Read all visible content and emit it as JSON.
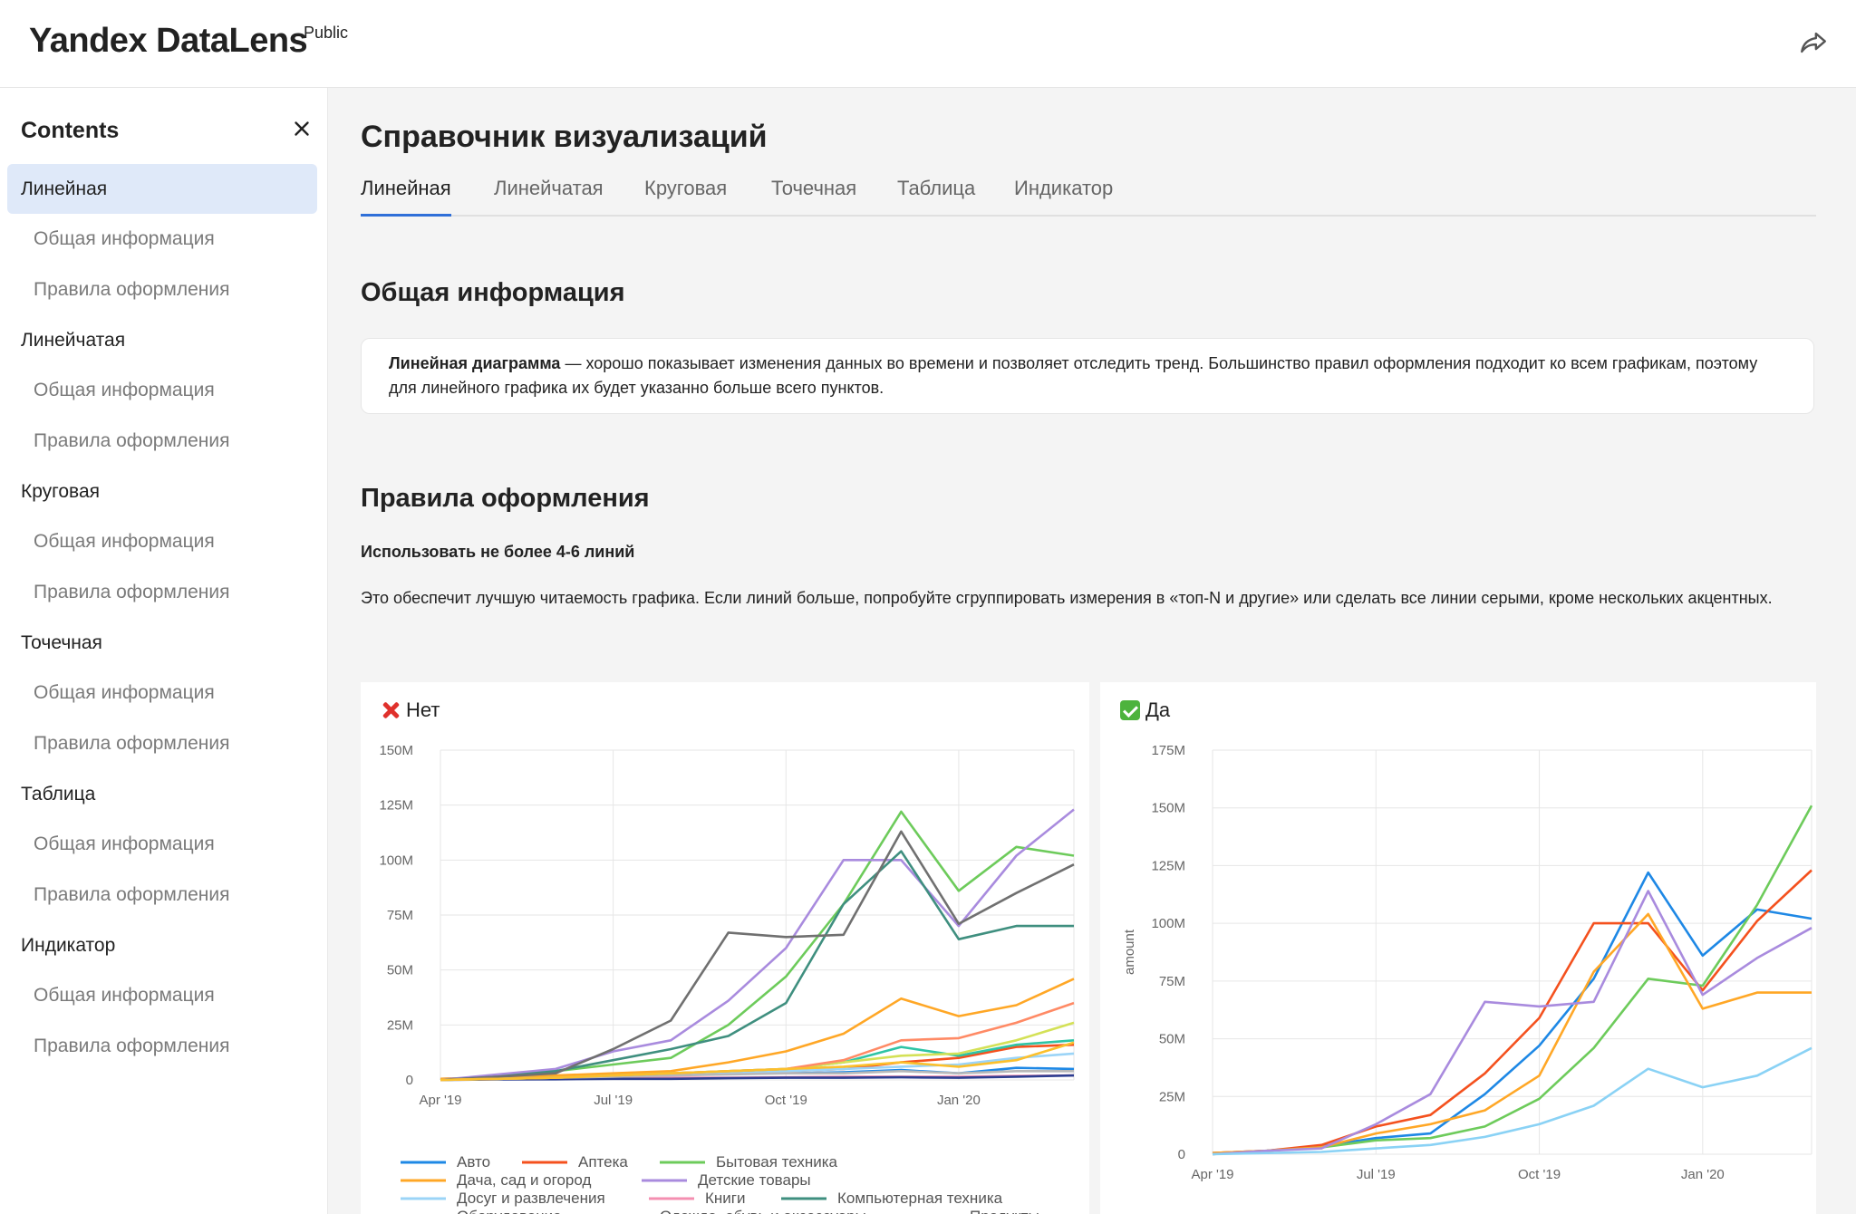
{
  "header": {
    "logo": "Yandex DataLens",
    "logo_badge": "Public",
    "share_icon": "share-icon"
  },
  "sidebar": {
    "title": "Contents",
    "close_icon": "close-icon",
    "items": [
      {
        "label": "Линейная",
        "level": 1,
        "active": true
      },
      {
        "label": "Общая информация",
        "level": 2
      },
      {
        "label": "Правила оформления",
        "level": 2
      },
      {
        "label": "Линейчатая",
        "level": 1
      },
      {
        "label": "Общая информация",
        "level": 2
      },
      {
        "label": "Правила оформления",
        "level": 2
      },
      {
        "label": "Круговая",
        "level": 1
      },
      {
        "label": "Общая информация",
        "level": 2
      },
      {
        "label": "Правила оформления",
        "level": 2
      },
      {
        "label": "Точечная",
        "level": 1
      },
      {
        "label": "Общая информация",
        "level": 2
      },
      {
        "label": "Правила оформления",
        "level": 2
      },
      {
        "label": "Таблица",
        "level": 1
      },
      {
        "label": "Общая информация",
        "level": 2
      },
      {
        "label": "Правила оформления",
        "level": 2
      },
      {
        "label": "Индикатор",
        "level": 1
      },
      {
        "label": "Общая информация",
        "level": 2
      },
      {
        "label": "Правила оформления",
        "level": 2
      }
    ]
  },
  "main": {
    "title": "Справочник визуализаций",
    "tabs": [
      {
        "label": "Линейная",
        "active": true
      },
      {
        "label": "Линейчатая"
      },
      {
        "label": "Круговая"
      },
      {
        "label": "Точечная"
      },
      {
        "label": "Таблица"
      },
      {
        "label": "Индикатор"
      }
    ],
    "section1_title": "Общая информация",
    "info_bold": "Линейная диаграмма",
    "info_text": " — хорошо показывает изменения данных во времени и позволяет отследить тренд. Большинство правил оформления подходит ко всем графикам, поэтому для линейного графика их будет указанно больше всего пунктов.",
    "section2_title": "Правила оформления",
    "rule_title": "Использовать не более 4-6 линий",
    "rule_text": "Это обеспечит лучшую читаемость графика. Если линий больше, попробуйте сгруппировать измерения в «топ-N и другие» или сделать все линии серыми, кроме нескольких акцентных.",
    "bad_label": "Нет",
    "good_label": "Да"
  },
  "chart_data": [
    {
      "type": "line",
      "title": "Нет",
      "x": [
        "Apr '19",
        "May '19",
        "Jun '19",
        "Jul '19",
        "Aug '19",
        "Sep '19",
        "Oct '19",
        "Nov '19",
        "Dec '19",
        "Jan '20",
        "Feb '20",
        "Mar '20"
      ],
      "x_ticks": [
        "Apr '19",
        "Jul '19",
        "Oct '19",
        "Jan '20"
      ],
      "y_ticks": [
        "0",
        "25M",
        "50M",
        "75M",
        "100M",
        "125M",
        "150M"
      ],
      "ylim": [
        0,
        150
      ],
      "ylabel": "",
      "legend": "bottom",
      "series": [
        {
          "name": "Авто",
          "color": "#1e88e5",
          "values": [
            0.5,
            1,
            2,
            2.5,
            2.5,
            3,
            3,
            3.5,
            4.5,
            3,
            5.5,
            5
          ]
        },
        {
          "name": "Аптека",
          "color": "#f4511e",
          "values": [
            0.5,
            1,
            1.5,
            2,
            2.5,
            3,
            4,
            5,
            8,
            10,
            15,
            16
          ]
        },
        {
          "name": "Бытовая техника",
          "color": "#6dcb5b",
          "values": [
            0,
            1.5,
            4,
            7,
            10,
            25,
            47,
            80,
            122,
            86,
            106,
            102
          ]
        },
        {
          "name": "Дача, сад и огород",
          "color": "#ffa726",
          "values": [
            0.5,
            1,
            2,
            3,
            4,
            8,
            13,
            21,
            37,
            29,
            34,
            46
          ]
        },
        {
          "name": "Детские товары",
          "color": "#a98bde",
          "values": [
            0,
            2.5,
            5,
            13,
            18,
            36,
            60,
            100,
            100,
            70,
            102,
            123
          ]
        },
        {
          "name": "Досуг и развлечения",
          "color": "#9bd4f7",
          "values": [
            0,
            0.5,
            1,
            1.5,
            2,
            3,
            4,
            5,
            6,
            7,
            10,
            12
          ]
        },
        {
          "name": "Книги",
          "color": "#f48fb1",
          "values": [
            0,
            0.5,
            0.5,
            0.8,
            1,
            1,
            1.2,
            1.5,
            1.5,
            1.5,
            1.8,
            2
          ]
        },
        {
          "name": "Компьютерная техника",
          "color": "#3f8f7f",
          "values": [
            0,
            1.5,
            4,
            9,
            14,
            20,
            35,
            80,
            104,
            64,
            70,
            70
          ]
        },
        {
          "name": "Оборудование",
          "color": "#2c3e91",
          "values": [
            0,
            0.2,
            0.3,
            0.5,
            0.5,
            0.8,
            1,
            1,
            1.2,
            1,
            1.5,
            2
          ]
        },
        {
          "name": "Одежда, обувь и аксессуары",
          "color": "#b8b8b8",
          "values": [
            0,
            0.5,
            1,
            1.5,
            2,
            2.5,
            3,
            3,
            4,
            3,
            4,
            4
          ]
        },
        {
          "name": "Продукты",
          "color": "#2ec4a5",
          "values": [
            0,
            0.5,
            1,
            2,
            3,
            4,
            5,
            8,
            15,
            11,
            16,
            18
          ]
        },
        {
          "name": "",
          "color": "#707070",
          "values": [
            0,
            1.5,
            3,
            14,
            27,
            67,
            65,
            66,
            113,
            71,
            85,
            98
          ]
        },
        {
          "name": "",
          "color": "#d4e157",
          "values": [
            0,
            0.5,
            1,
            2,
            3,
            4,
            5,
            8,
            11,
            12,
            18,
            26
          ]
        },
        {
          "name": "",
          "color": "#ff8a65",
          "values": [
            0,
            0.5,
            1,
            2,
            3,
            4,
            5,
            9,
            18,
            19,
            26,
            35
          ]
        },
        {
          "name": "",
          "color": "#fbc02d",
          "values": [
            0,
            0.5,
            1,
            2,
            3,
            4,
            5,
            6,
            8,
            6,
            9,
            17
          ]
        }
      ]
    },
    {
      "type": "line",
      "title": "Да",
      "x": [
        "Apr '19",
        "May '19",
        "Jun '19",
        "Jul '19",
        "Aug '19",
        "Sep '19",
        "Oct '19",
        "Nov '19",
        "Dec '19",
        "Jan '20",
        "Feb '20",
        "Mar '20"
      ],
      "x_ticks": [
        "Apr '19",
        "Jul '19",
        "Oct '19",
        "Jan '20"
      ],
      "y_ticks": [
        "0",
        "25M",
        "50M",
        "75M",
        "100M",
        "125M",
        "150M",
        "175M"
      ],
      "ylim": [
        0,
        175
      ],
      "ylabel": "amount",
      "series": [
        {
          "color": "#1e88e5",
          "values": [
            0.5,
            1.5,
            3.5,
            7,
            9,
            26,
            47,
            76,
            122,
            86,
            106,
            102
          ]
        },
        {
          "color": "#f4511e",
          "values": [
            0.5,
            1.5,
            4,
            12,
            17,
            35,
            59,
            100,
            100,
            71,
            101,
            123
          ]
        },
        {
          "color": "#6dcb5b",
          "values": [
            0,
            1.5,
            3,
            6,
            7,
            12,
            24,
            46,
            76,
            73,
            108,
            151
          ]
        },
        {
          "color": "#ffa726",
          "values": [
            0.5,
            1.5,
            3,
            9,
            13,
            19,
            34,
            79,
            104,
            63,
            70,
            70
          ]
        },
        {
          "color": "#a98bde",
          "values": [
            0,
            1.5,
            2.5,
            13,
            26,
            66,
            64,
            66,
            114,
            69,
            85,
            98
          ]
        },
        {
          "color": "#8ad2f5",
          "values": [
            0,
            0.5,
            1,
            2.5,
            4,
            7.5,
            13,
            21,
            37,
            29,
            34,
            46
          ]
        }
      ]
    }
  ]
}
